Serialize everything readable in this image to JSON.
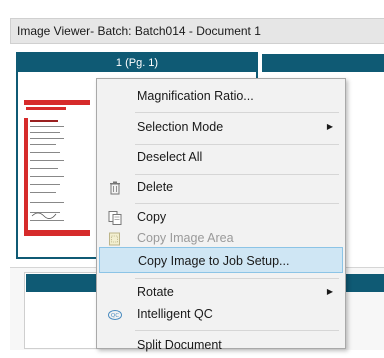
{
  "window": {
    "title": "Image Viewer- Batch: Batch014 - Document 1"
  },
  "pages": [
    {
      "label": "1 (Pg. 1)"
    }
  ],
  "colors": {
    "tile_header": "#0f5a74",
    "menu_highlight": "#cfe6f4",
    "menu_highlight_border": "#8cc4e6",
    "stamp_red": "#d62b2b"
  },
  "context_menu": {
    "items": [
      {
        "label": "Magnification Ratio...",
        "icon": null,
        "submenu": false,
        "disabled": false
      },
      {
        "label": "Selection Mode",
        "icon": null,
        "submenu": true,
        "disabled": false
      },
      {
        "label": "Deselect All",
        "icon": null,
        "submenu": false,
        "disabled": false
      },
      {
        "label": "Delete",
        "icon": "trash-icon",
        "submenu": false,
        "disabled": false
      },
      {
        "label": "Copy",
        "icon": "copy-icon",
        "submenu": false,
        "disabled": false
      },
      {
        "label": "Copy Image Area",
        "icon": "copy-image-area-icon",
        "submenu": false,
        "disabled": true
      },
      {
        "label": "Copy Image to Job Setup...",
        "icon": null,
        "submenu": false,
        "disabled": false,
        "highlighted": true
      },
      {
        "label": "Rotate",
        "icon": null,
        "submenu": true,
        "disabled": false
      },
      {
        "label": "Intelligent QC",
        "icon": "intelligent-qc-icon",
        "submenu": false,
        "disabled": false
      },
      {
        "label": "Split Document",
        "icon": null,
        "submenu": false,
        "disabled": false
      }
    ],
    "submenu_arrow": "▶"
  }
}
